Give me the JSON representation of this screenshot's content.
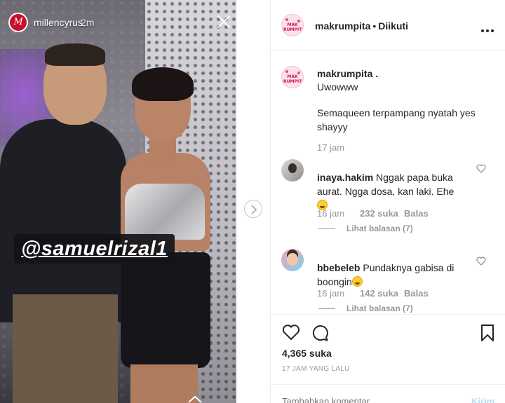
{
  "story": {
    "username": "millencyrus",
    "time": "2m",
    "tag": "@samuelrizal1",
    "avatar_letter": "M"
  },
  "post": {
    "owner": "makrumpita",
    "follow_status": "Diikuti",
    "avatar_text": "MAK RUMPITA",
    "caption": {
      "username": "makrumpita .",
      "line1": "Uwowww",
      "line2": "Semaqueen terpampang nyatah yes shayyy",
      "time": "17 jam"
    },
    "comments": [
      {
        "username": "inaya.hakim",
        "text": "Nggak papa buka aurat. Ngga dosa, kan laki. Ehe",
        "emoji": "grin-emoji",
        "time": "16 jam",
        "likes": "232 suka",
        "reply": "Balas",
        "view_replies": "Lihat balasan (7)"
      },
      {
        "username": "bbebeleb",
        "text": "Pundaknya gabisa di boongin",
        "emoji": "sweat-smile-emoji",
        "time": "16 jam",
        "likes": "142 suka",
        "reply": "Balas",
        "view_replies": "Lihat balasan (7)"
      }
    ],
    "likes": "4,365 suka",
    "posted_ago": "17 JAM YANG LALU",
    "comment_placeholder": "Tambahkan komentar...",
    "post_button": "Kirim"
  },
  "colors": {
    "accent": "#0095f6",
    "post_button_disabled": "#b2dffc",
    "muted_text": "#999999",
    "story_avatar": "#c8102e"
  }
}
